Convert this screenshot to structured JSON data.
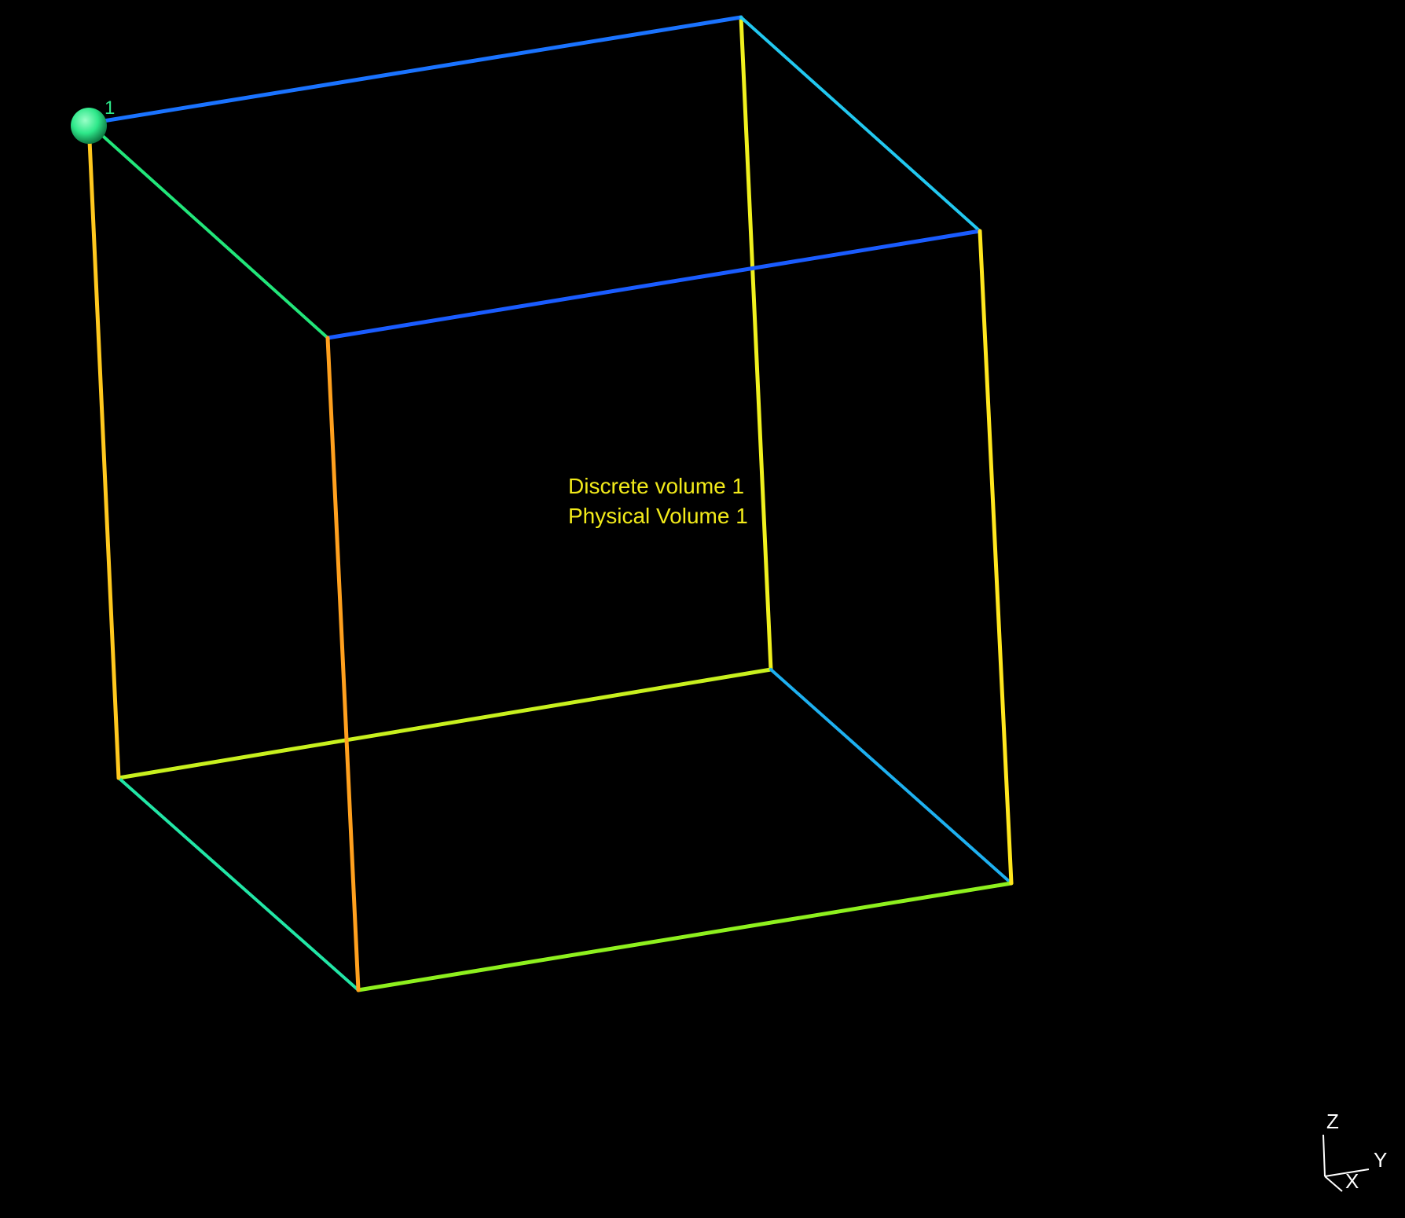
{
  "viewport": {
    "background": "#000000"
  },
  "volume": {
    "name_line": "Discrete volume 1",
    "physical_line": "Physical Volume 1",
    "label_color": "#f2ea1a"
  },
  "point": {
    "label": "1",
    "color": "#2ee88a"
  },
  "axes": {
    "z": "Z",
    "y": "Y",
    "x": "X",
    "color": "#ffffff"
  },
  "edge_colors": {
    "top_back": "#1a73ff",
    "top_front": "#1a5cff",
    "top_left": "#22e67a",
    "top_right": "#22c8f0",
    "bottom_back": "#c8f01e",
    "bottom_front": "#8ef01e",
    "bottom_left": "#22e6a6",
    "bottom_right": "#1eb0f0",
    "vert_left_back": "#ffc81e",
    "vert_left_front": "#ffa01e",
    "vert_right_back": "#f0f01e",
    "vert_right_front": "#ffe61e"
  }
}
